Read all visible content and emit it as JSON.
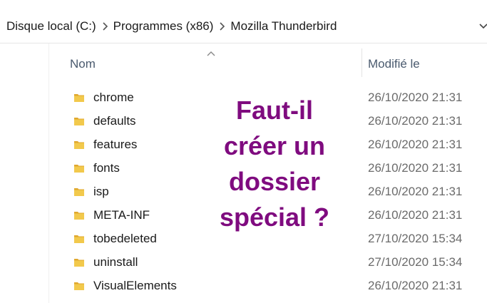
{
  "address_bar": {
    "breadcrumbs": [
      "Disque local (C:)",
      "Programmes (x86)",
      "Mozilla Thunderbird"
    ]
  },
  "file_list": {
    "columns": {
      "name": "Nom",
      "date_modified": "Modifié le"
    },
    "rows": [
      {
        "name": "chrome",
        "date": "26/10/2020 21:31",
        "icon": "folder-icon"
      },
      {
        "name": "defaults",
        "date": "26/10/2020 21:31",
        "icon": "folder-icon"
      },
      {
        "name": "features",
        "date": "26/10/2020 21:31",
        "icon": "folder-icon"
      },
      {
        "name": "fonts",
        "date": "26/10/2020 21:31",
        "icon": "folder-icon"
      },
      {
        "name": "isp",
        "date": "26/10/2020 21:31",
        "icon": "folder-icon"
      },
      {
        "name": "META-INF",
        "date": "26/10/2020 21:31",
        "icon": "folder-icon"
      },
      {
        "name": "tobedeleted",
        "date": "27/10/2020 15:34",
        "icon": "folder-icon"
      },
      {
        "name": "uninstall",
        "date": "27/10/2020 15:34",
        "icon": "folder-icon"
      },
      {
        "name": "VisualElements",
        "date": "26/10/2020 21:31",
        "icon": "folder-icon"
      }
    ]
  },
  "overlay_text": {
    "lines": [
      "Faut-il",
      "créer un",
      "dossier",
      "spécial ?"
    ],
    "color": "#7f0b7f"
  },
  "colors": {
    "folder": "#f2c94c",
    "folder_dark": "#e0a82e",
    "header_text": "#4a5a6e"
  }
}
